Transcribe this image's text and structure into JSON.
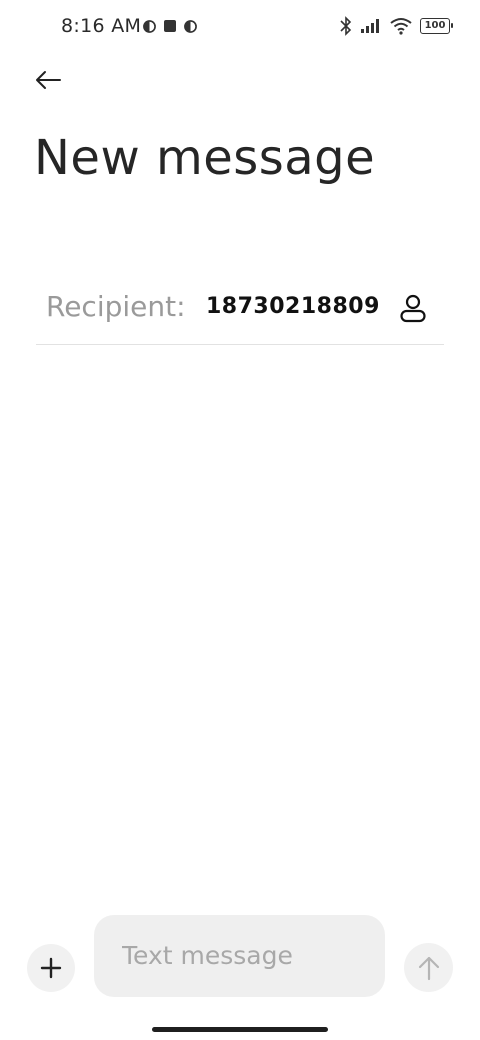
{
  "status_bar": {
    "time": "8:16 AM",
    "left_icons": [
      "half-circle-icon",
      "square-icon",
      "half-circle-icon"
    ],
    "right_icons": [
      "bluetooth-icon",
      "signal-icon",
      "wifi-icon",
      "battery-icon"
    ],
    "battery_level": "100"
  },
  "header": {
    "title": "New message"
  },
  "recipient": {
    "label": "Recipient:",
    "value": "18730218809"
  },
  "composer": {
    "placeholder": "Text message",
    "value": ""
  },
  "colors": {
    "background": "#ffffff",
    "title": "#262626",
    "muted": "#9a9a9a",
    "input_bg": "#efefef"
  }
}
